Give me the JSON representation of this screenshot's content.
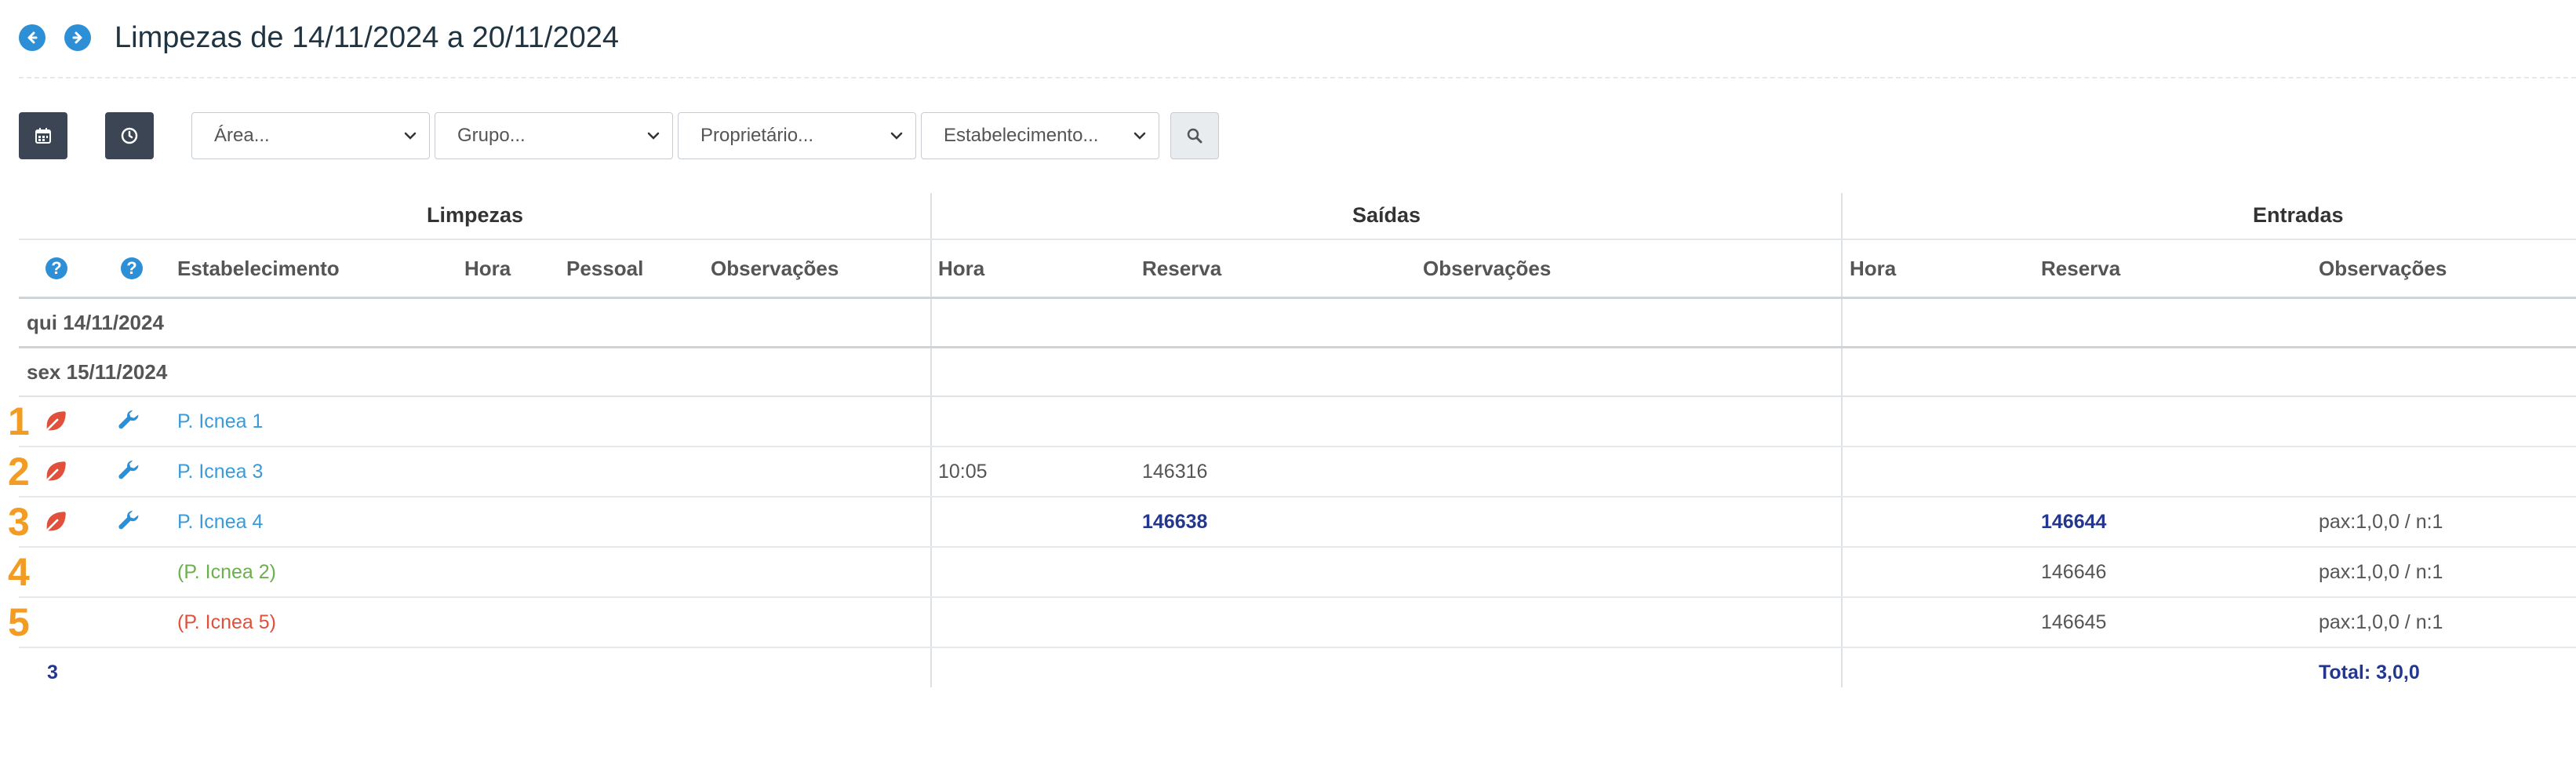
{
  "header": {
    "title": "Limpezas de 14/11/2024 a 20/11/2024"
  },
  "icons": {
    "prev": "arrow-left-circle-icon",
    "next": "arrow-right-circle-icon"
  },
  "filters": {
    "area": "Área...",
    "grupo": "Grupo...",
    "proprietario": "Proprietário...",
    "estabelecimento": "Estabelecimento..."
  },
  "groups": {
    "limpezas": "Limpezas",
    "saidas": "Saídas",
    "entradas": "Entradas"
  },
  "columns": {
    "estabelecimento": "Estabelecimento",
    "hora": "Hora",
    "pessoal": "Pessoal",
    "observacoes": "Observações",
    "saidas_hora": "Hora",
    "saidas_reserva": "Reserva",
    "saidas_obs": "Observações",
    "entradas_hora": "Hora",
    "entradas_reserva": "Reserva",
    "entradas_obs": "Observações"
  },
  "days": [
    "qui 14/11/2024",
    "sex 15/11/2024"
  ],
  "rows": [
    {
      "num": "1",
      "estab": "P. Icnea 1",
      "saida_hora": "",
      "saida_reserva": "",
      "entrada_reserva": "",
      "entrada_obs": ""
    },
    {
      "num": "2",
      "estab": "P. Icnea 3",
      "saida_hora": "10:05",
      "saida_reserva": "146316",
      "entrada_reserva": "",
      "entrada_obs": ""
    },
    {
      "num": "3",
      "estab": "P. Icnea 4",
      "saida_hora": "",
      "saida_reserva": "146638",
      "entrada_reserva": "146644",
      "entrada_obs": "pax:1,0,0 / n:1"
    },
    {
      "num": "4",
      "estab": "(P. Icnea 2)",
      "saida_hora": "",
      "saida_reserva": "",
      "entrada_reserva": "146646",
      "entrada_obs": "pax:1,0,0 / n:1"
    },
    {
      "num": "5",
      "estab": "(P. Icnea 5)",
      "saida_hora": "",
      "saida_reserva": "",
      "entrada_reserva": "146645",
      "entrada_obs": "pax:1,0,0 / n:1"
    }
  ],
  "totals": {
    "count": "3",
    "total": "Total: 3,0,0"
  },
  "colors": {
    "accent": "#2d8fd6",
    "orange": "#f39c24",
    "leaf": "#e0503a",
    "dark_blue": "#24378f",
    "green": "#6ab04c"
  }
}
